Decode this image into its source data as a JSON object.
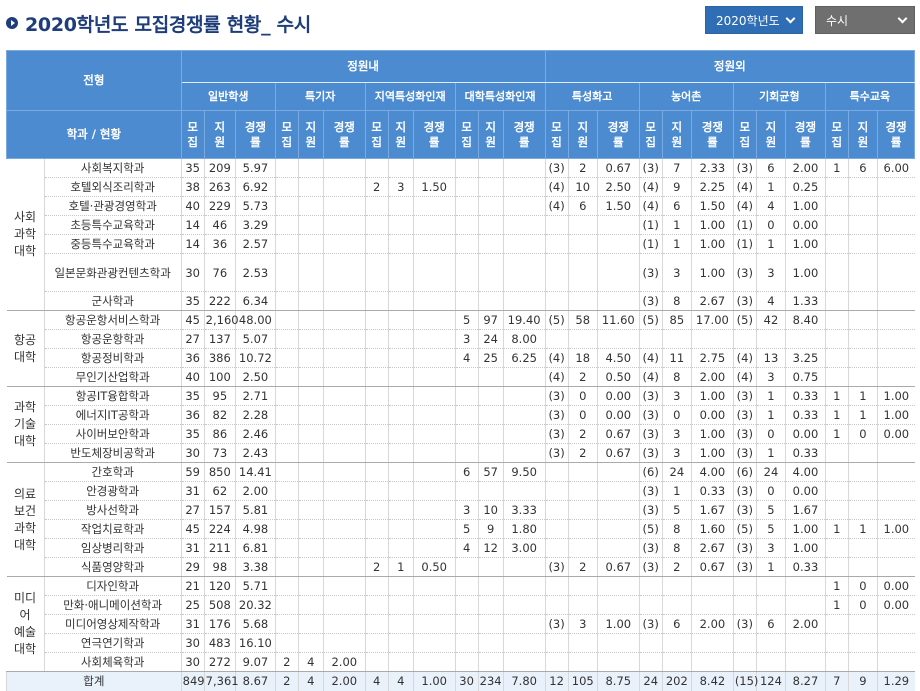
{
  "title": "2020학년도 모집경쟁률 현황_ 수시",
  "selects": {
    "year": "2020학년도",
    "type": "수시"
  },
  "header": {
    "jeonhyeong": "전형",
    "dept_label": "학과 / 현황",
    "inside": "정원내",
    "outside": "정원외",
    "groups": [
      "일반학생",
      "특기자",
      "지역특성화인재",
      "대학특성화인재",
      "특성화고",
      "농어촌",
      "기회균형",
      "특수교육"
    ],
    "cols": [
      "모집",
      "지원",
      "경쟁률"
    ]
  },
  "colleges": [
    {
      "name": "사회\n과학\n대학",
      "rows": [
        {
          "dept": "사회복지학과",
          "cells": [
            "35",
            "209",
            "5.97",
            "",
            "",
            "",
            "",
            "",
            "",
            "",
            "",
            "",
            "(3)",
            "2",
            "0.67",
            "(3)",
            "7",
            "2.33",
            "(3)",
            "6",
            "2.00",
            "1",
            "6",
            "6.00"
          ]
        },
        {
          "dept": "호텔외식조리학과",
          "cells": [
            "38",
            "263",
            "6.92",
            "",
            "",
            "",
            "2",
            "3",
            "1.50",
            "",
            "",
            "",
            "(4)",
            "10",
            "2.50",
            "(4)",
            "9",
            "2.25",
            "(4)",
            "1",
            "0.25",
            "",
            "",
            ""
          ]
        },
        {
          "dept": "호텔·관광경영학과",
          "cells": [
            "40",
            "229",
            "5.73",
            "",
            "",
            "",
            "",
            "",
            "",
            "",
            "",
            "",
            "(4)",
            "6",
            "1.50",
            "(4)",
            "6",
            "1.50",
            "(4)",
            "4",
            "1.00",
            "",
            "",
            ""
          ]
        },
        {
          "dept": "초등특수교육학과",
          "cells": [
            "14",
            "46",
            "3.29",
            "",
            "",
            "",
            "",
            "",
            "",
            "",
            "",
            "",
            "",
            "",
            "",
            "(1)",
            "1",
            "1.00",
            "(1)",
            "0",
            "0.00",
            "",
            "",
            ""
          ]
        },
        {
          "dept": "중등특수교육학과",
          "cells": [
            "14",
            "36",
            "2.57",
            "",
            "",
            "",
            "",
            "",
            "",
            "",
            "",
            "",
            "",
            "",
            "",
            "(1)",
            "1",
            "1.00",
            "(1)",
            "1",
            "1.00",
            "",
            "",
            ""
          ]
        },
        {
          "dept": "일본문화관광컨텐츠학과",
          "tall": true,
          "cells": [
            "30",
            "76",
            "2.53",
            "",
            "",
            "",
            "",
            "",
            "",
            "",
            "",
            "",
            "",
            "",
            "",
            "(3)",
            "3",
            "1.00",
            "(3)",
            "3",
            "1.00",
            "",
            "",
            ""
          ]
        },
        {
          "dept": "군사학과",
          "cells": [
            "35",
            "222",
            "6.34",
            "",
            "",
            "",
            "",
            "",
            "",
            "",
            "",
            "",
            "",
            "",
            "",
            "(3)",
            "8",
            "2.67",
            "(3)",
            "4",
            "1.33",
            "",
            "",
            ""
          ]
        }
      ]
    },
    {
      "name": "항공\n대학",
      "rows": [
        {
          "dept": "항공운항서비스학과",
          "cells": [
            "45",
            "2,160",
            "48.00",
            "",
            "",
            "",
            "",
            "",
            "",
            "5",
            "97",
            "19.40",
            "(5)",
            "58",
            "11.60",
            "(5)",
            "85",
            "17.00",
            "(5)",
            "42",
            "8.40",
            "",
            "",
            ""
          ]
        },
        {
          "dept": "항공운항학과",
          "cells": [
            "27",
            "137",
            "5.07",
            "",
            "",
            "",
            "",
            "",
            "",
            "3",
            "24",
            "8.00",
            "",
            "",
            "",
            "",
            "",
            "",
            "",
            "",
            "",
            "",
            "",
            ""
          ]
        },
        {
          "dept": "항공정비학과",
          "cells": [
            "36",
            "386",
            "10.72",
            "",
            "",
            "",
            "",
            "",
            "",
            "4",
            "25",
            "6.25",
            "(4)",
            "18",
            "4.50",
            "(4)",
            "11",
            "2.75",
            "(4)",
            "13",
            "3.25",
            "",
            "",
            ""
          ]
        },
        {
          "dept": "무인기산업학과",
          "cells": [
            "40",
            "100",
            "2.50",
            "",
            "",
            "",
            "",
            "",
            "",
            "",
            "",
            "",
            "(4)",
            "2",
            "0.50",
            "(4)",
            "8",
            "2.00",
            "(4)",
            "3",
            "0.75",
            "",
            "",
            ""
          ]
        }
      ]
    },
    {
      "name": "과학\n기술\n대학",
      "rows": [
        {
          "dept": "항공IT융합학과",
          "cells": [
            "35",
            "95",
            "2.71",
            "",
            "",
            "",
            "",
            "",
            "",
            "",
            "",
            "",
            "(3)",
            "0",
            "0.00",
            "(3)",
            "3",
            "1.00",
            "(3)",
            "1",
            "0.33",
            "1",
            "1",
            "1.00"
          ]
        },
        {
          "dept": "에너지IT공학과",
          "cells": [
            "36",
            "82",
            "2.28",
            "",
            "",
            "",
            "",
            "",
            "",
            "",
            "",
            "",
            "(3)",
            "0",
            "0.00",
            "(3)",
            "0",
            "0.00",
            "(3)",
            "1",
            "0.33",
            "1",
            "1",
            "1.00"
          ]
        },
        {
          "dept": "사이버보안학과",
          "cells": [
            "35",
            "86",
            "2.46",
            "",
            "",
            "",
            "",
            "",
            "",
            "",
            "",
            "",
            "(3)",
            "2",
            "0.67",
            "(3)",
            "3",
            "1.00",
            "(3)",
            "0",
            "0.00",
            "1",
            "0",
            "0.00"
          ]
        },
        {
          "dept": "반도체장비공학과",
          "cells": [
            "30",
            "73",
            "2.43",
            "",
            "",
            "",
            "",
            "",
            "",
            "",
            "",
            "",
            "(3)",
            "2",
            "0.67",
            "(3)",
            "3",
            "1.00",
            "(3)",
            "1",
            "0.33",
            "",
            "",
            ""
          ]
        }
      ]
    },
    {
      "name": "의료\n보건\n과학\n대학",
      "rows": [
        {
          "dept": "간호학과",
          "cells": [
            "59",
            "850",
            "14.41",
            "",
            "",
            "",
            "",
            "",
            "",
            "6",
            "57",
            "9.50",
            "",
            "",
            "",
            "(6)",
            "24",
            "4.00",
            "(6)",
            "24",
            "4.00",
            "",
            "",
            ""
          ]
        },
        {
          "dept": "안경광학과",
          "cells": [
            "31",
            "62",
            "2.00",
            "",
            "",
            "",
            "",
            "",
            "",
            "",
            "",
            "",
            "",
            "",
            "",
            "(3)",
            "1",
            "0.33",
            "(3)",
            "0",
            "0.00",
            "",
            "",
            ""
          ]
        },
        {
          "dept": "방사선학과",
          "cells": [
            "27",
            "157",
            "5.81",
            "",
            "",
            "",
            "",
            "",
            "",
            "3",
            "10",
            "3.33",
            "",
            "",
            "",
            "(3)",
            "5",
            "1.67",
            "(3)",
            "5",
            "1.67",
            "",
            "",
            ""
          ]
        },
        {
          "dept": "작업치료학과",
          "cells": [
            "45",
            "224",
            "4.98",
            "",
            "",
            "",
            "",
            "",
            "",
            "5",
            "9",
            "1.80",
            "",
            "",
            "",
            "(5)",
            "8",
            "1.60",
            "(5)",
            "5",
            "1.00",
            "1",
            "1",
            "1.00"
          ]
        },
        {
          "dept": "임상병리학과",
          "cells": [
            "31",
            "211",
            "6.81",
            "",
            "",
            "",
            "",
            "",
            "",
            "4",
            "12",
            "3.00",
            "",
            "",
            "",
            "(3)",
            "8",
            "2.67",
            "(3)",
            "3",
            "1.00",
            "",
            "",
            ""
          ]
        },
        {
          "dept": "식품영양학과",
          "cells": [
            "29",
            "98",
            "3.38",
            "",
            "",
            "",
            "2",
            "1",
            "0.50",
            "",
            "",
            "",
            "(3)",
            "2",
            "0.67",
            "(3)",
            "2",
            "0.67",
            "(3)",
            "1",
            "0.33",
            "",
            "",
            ""
          ]
        }
      ]
    },
    {
      "name": "미디\n어\n예술\n대학",
      "rows": [
        {
          "dept": "디자인학과",
          "cells": [
            "21",
            "120",
            "5.71",
            "",
            "",
            "",
            "",
            "",
            "",
            "",
            "",
            "",
            "",
            "",
            "",
            "",
            "",
            "",
            "",
            "",
            "",
            "1",
            "0",
            "0.00"
          ]
        },
        {
          "dept": "만화·애니메이션학과",
          "cells": [
            "25",
            "508",
            "20.32",
            "",
            "",
            "",
            "",
            "",
            "",
            "",
            "",
            "",
            "",
            "",
            "",
            "",
            "",
            "",
            "",
            "",
            "",
            "1",
            "0",
            "0.00"
          ]
        },
        {
          "dept": "미디어영상제작학과",
          "cells": [
            "31",
            "176",
            "5.68",
            "",
            "",
            "",
            "",
            "",
            "",
            "",
            "",
            "",
            "(3)",
            "3",
            "1.00",
            "(3)",
            "6",
            "2.00",
            "(3)",
            "6",
            "2.00",
            "",
            "",
            ""
          ]
        },
        {
          "dept": "연극연기학과",
          "cells": [
            "30",
            "483",
            "16.10",
            "",
            "",
            "",
            "",
            "",
            "",
            "",
            "",
            "",
            "",
            "",
            "",
            "",
            "",
            "",
            "",
            "",
            "",
            "",
            "",
            ""
          ]
        },
        {
          "dept": "사회체육학과",
          "cells": [
            "30",
            "272",
            "9.07",
            "2",
            "4",
            "2.00",
            "",
            "",
            "",
            "",
            "",
            "",
            "",
            "",
            "",
            "",
            "",
            "",
            "",
            "",
            "",
            "",
            "",
            ""
          ]
        }
      ]
    }
  ],
  "total": {
    "label": "합계",
    "cells": [
      "849",
      "7,361",
      "8.67",
      "2",
      "4",
      "2.00",
      "4",
      "4",
      "1.00",
      "30",
      "234",
      "7.80",
      "12",
      "105",
      "8.75",
      "24",
      "202",
      "8.42",
      "(15)",
      "124",
      "8.27",
      "7",
      "9",
      "1.29"
    ]
  }
}
